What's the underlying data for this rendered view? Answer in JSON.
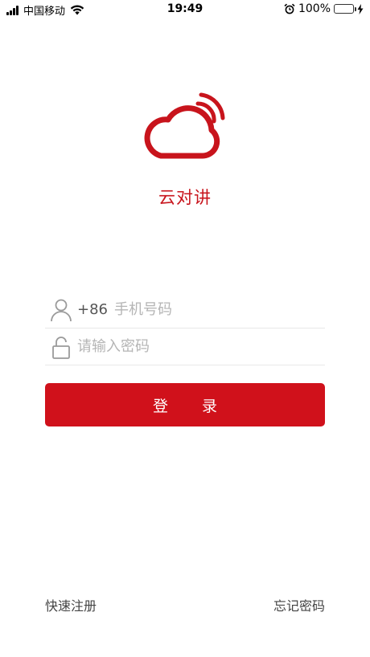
{
  "status_bar": {
    "carrier": "中国移动",
    "time": "19:49",
    "battery": "100%",
    "icons": [
      "signal-icon",
      "wifi-icon",
      "alarm-icon",
      "battery-icon",
      "charging-icon"
    ]
  },
  "app": {
    "name": "云对讲",
    "brand_color": "#c8141c"
  },
  "login_form": {
    "phone_prefix": "+86",
    "phone_placeholder": "手机号码",
    "password_placeholder": "请输入密码",
    "login_label": "登 录"
  },
  "links": {
    "register": "快速注册",
    "forgot_password": "忘记密码"
  }
}
